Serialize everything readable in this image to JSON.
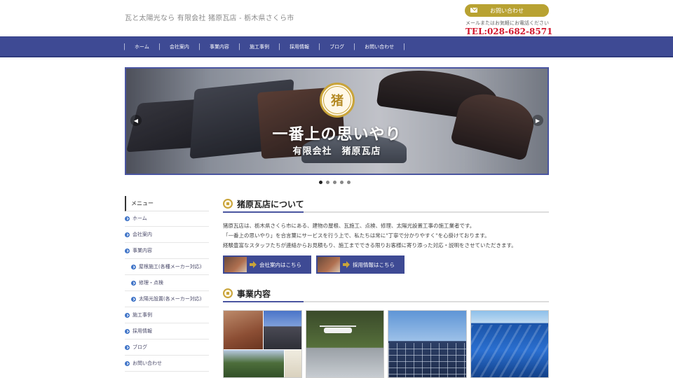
{
  "header": {
    "tagline": "瓦と太陽光なら 有限会社 猪原瓦店 - 栃木県さくら市",
    "contact_button": "お問い合わせ",
    "call_note": "メールまたはお気軽にお電話ください",
    "tel": "TEL:028-682-8571"
  },
  "nav": {
    "items": [
      "ホーム",
      "会社案内",
      "事業内容",
      "施工事例",
      "採用情報",
      "ブログ",
      "お問い合わせ"
    ]
  },
  "slider": {
    "emblem_char": "猪",
    "catch": "一番上の思いやり",
    "sub": "有限会社　猪原瓦店",
    "slide_count": 5,
    "active_slide": 1
  },
  "sidebar": {
    "title": "メニュー",
    "items": [
      {
        "label": "ホーム"
      },
      {
        "label": "会社案内"
      },
      {
        "label": "事業内容"
      },
      {
        "label": "屋根施工(各種メーカー対応)"
      },
      {
        "label": "修理・点検"
      },
      {
        "label": "太陽光設置(各メーカー対応)"
      },
      {
        "label": "施工事例"
      },
      {
        "label": "採用情報"
      },
      {
        "label": "ブログ"
      },
      {
        "label": "お問い合わせ"
      }
    ]
  },
  "about": {
    "heading": "猪原瓦店について",
    "lines": [
      "猪原瓦店は、栃木県さくら市にある、建物の屋根、瓦施工、点検、修理、太陽光設置工事の施工業者です。",
      "「一番上の思いやり」を合言葉にサービスを行う上で、私たちは常に\"丁寧で分かりやすく\"を心掛けております。",
      "経験豊富なスタッフたちが連絡からお見積もり、施工までできる限りお客様に寄り添った対応・説明をさせていただきます。"
    ],
    "banner_company": "会社案内はこちら",
    "banner_recruit": "採用情報はこちら"
  },
  "business": {
    "heading": "事業内容"
  },
  "colors": {
    "nav": "#3e4a94",
    "gold": "#b8a232",
    "tel": "#d2162c"
  }
}
